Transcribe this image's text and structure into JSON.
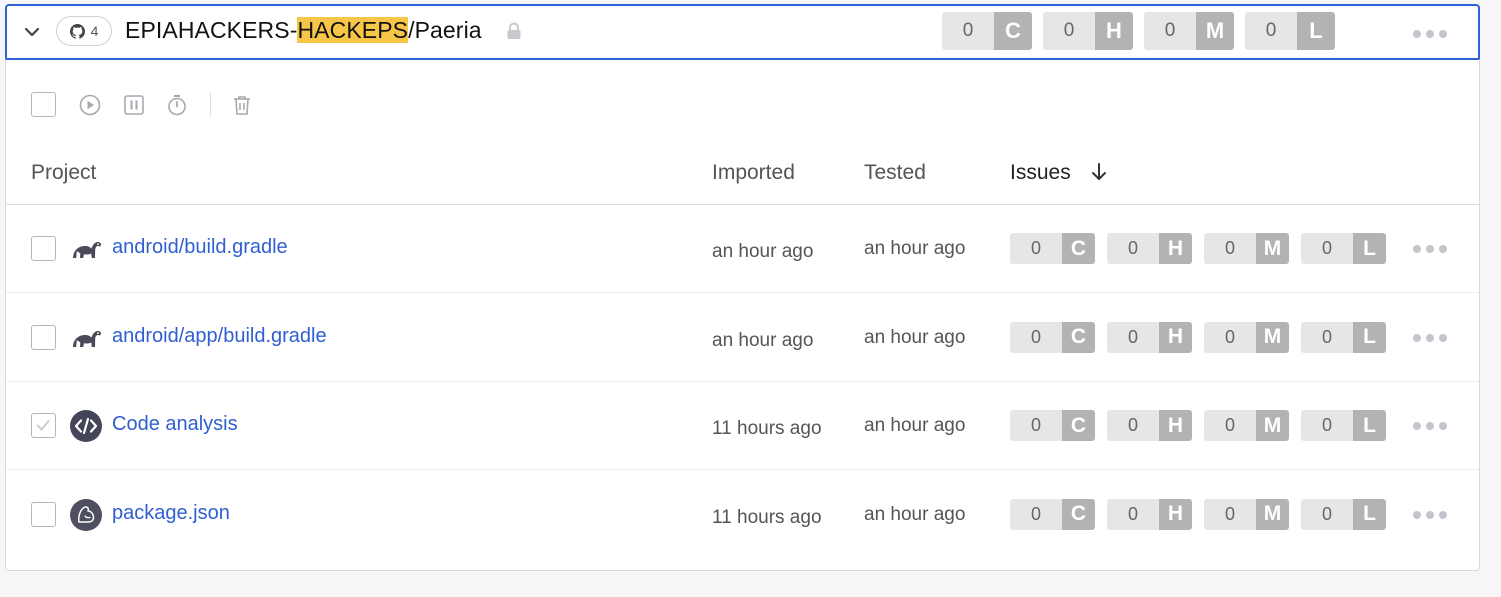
{
  "header": {
    "repo_count": "4",
    "title_prefix": "EPIAHACKERS-",
    "title_highlight": "HACKEPS",
    "title_suffix": "/Paeria",
    "severity": [
      {
        "count": "0",
        "letter": "C"
      },
      {
        "count": "0",
        "letter": "H"
      },
      {
        "count": "0",
        "letter": "M"
      },
      {
        "count": "0",
        "letter": "L"
      }
    ]
  },
  "toolbar": {
    "icons": [
      "play-icon",
      "pause-icon",
      "timer-icon",
      "trash-icon"
    ]
  },
  "columns": {
    "project": "Project",
    "imported": "Imported",
    "tested": "Tested",
    "issues": "Issues"
  },
  "rows": [
    {
      "name": "android/build.gradle",
      "icon": "gradle-icon",
      "checked": false,
      "imported": "an hour ago",
      "tested": "an hour ago",
      "severity": [
        {
          "count": "0",
          "letter": "C"
        },
        {
          "count": "0",
          "letter": "H"
        },
        {
          "count": "0",
          "letter": "M"
        },
        {
          "count": "0",
          "letter": "L"
        }
      ]
    },
    {
      "name": "android/app/build.gradle",
      "icon": "gradle-icon",
      "checked": false,
      "imported": "an hour ago",
      "tested": "an hour ago",
      "severity": [
        {
          "count": "0",
          "letter": "C"
        },
        {
          "count": "0",
          "letter": "H"
        },
        {
          "count": "0",
          "letter": "M"
        },
        {
          "count": "0",
          "letter": "L"
        }
      ]
    },
    {
      "name": "Code analysis",
      "icon": "code-icon",
      "checked": true,
      "imported": "11 hours ago",
      "tested": "an hour ago",
      "severity": [
        {
          "count": "0",
          "letter": "C"
        },
        {
          "count": "0",
          "letter": "H"
        },
        {
          "count": "0",
          "letter": "M"
        },
        {
          "count": "0",
          "letter": "L"
        }
      ]
    },
    {
      "name": "package.json",
      "icon": "npm-icon",
      "checked": false,
      "imported": "11 hours ago",
      "tested": "an hour ago",
      "severity": [
        {
          "count": "0",
          "letter": "C"
        },
        {
          "count": "0",
          "letter": "H"
        },
        {
          "count": "0",
          "letter": "M"
        },
        {
          "count": "0",
          "letter": "L"
        }
      ]
    }
  ],
  "colors": {
    "accent_border": "#2f60d6",
    "link": "#2f5fd0",
    "highlight": "#f7c548",
    "severity_count_bg": "#e6e6e6",
    "severity_letter_bg": "#b3b3b3"
  }
}
